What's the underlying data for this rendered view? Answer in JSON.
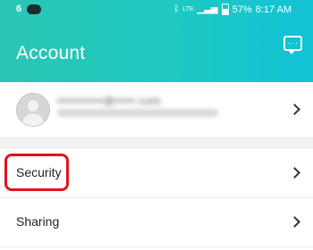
{
  "statusbar": {
    "left_number": "6",
    "signal_label": "LTE",
    "battery": "57%",
    "time": "8:17 AM"
  },
  "header": {
    "title": "Account",
    "action_icon": "chat-bubble-icon"
  },
  "profile": {
    "email": "•••••••••••@•••••.com"
  },
  "menu": {
    "items": [
      {
        "label": "Security",
        "icon": "chevron-right-icon"
      },
      {
        "label": "Sharing",
        "icon": "chevron-right-icon"
      }
    ]
  },
  "colors": {
    "header_start": "#2bc5b4",
    "header_end": "#12c2d6",
    "highlight": "#e0141b"
  }
}
